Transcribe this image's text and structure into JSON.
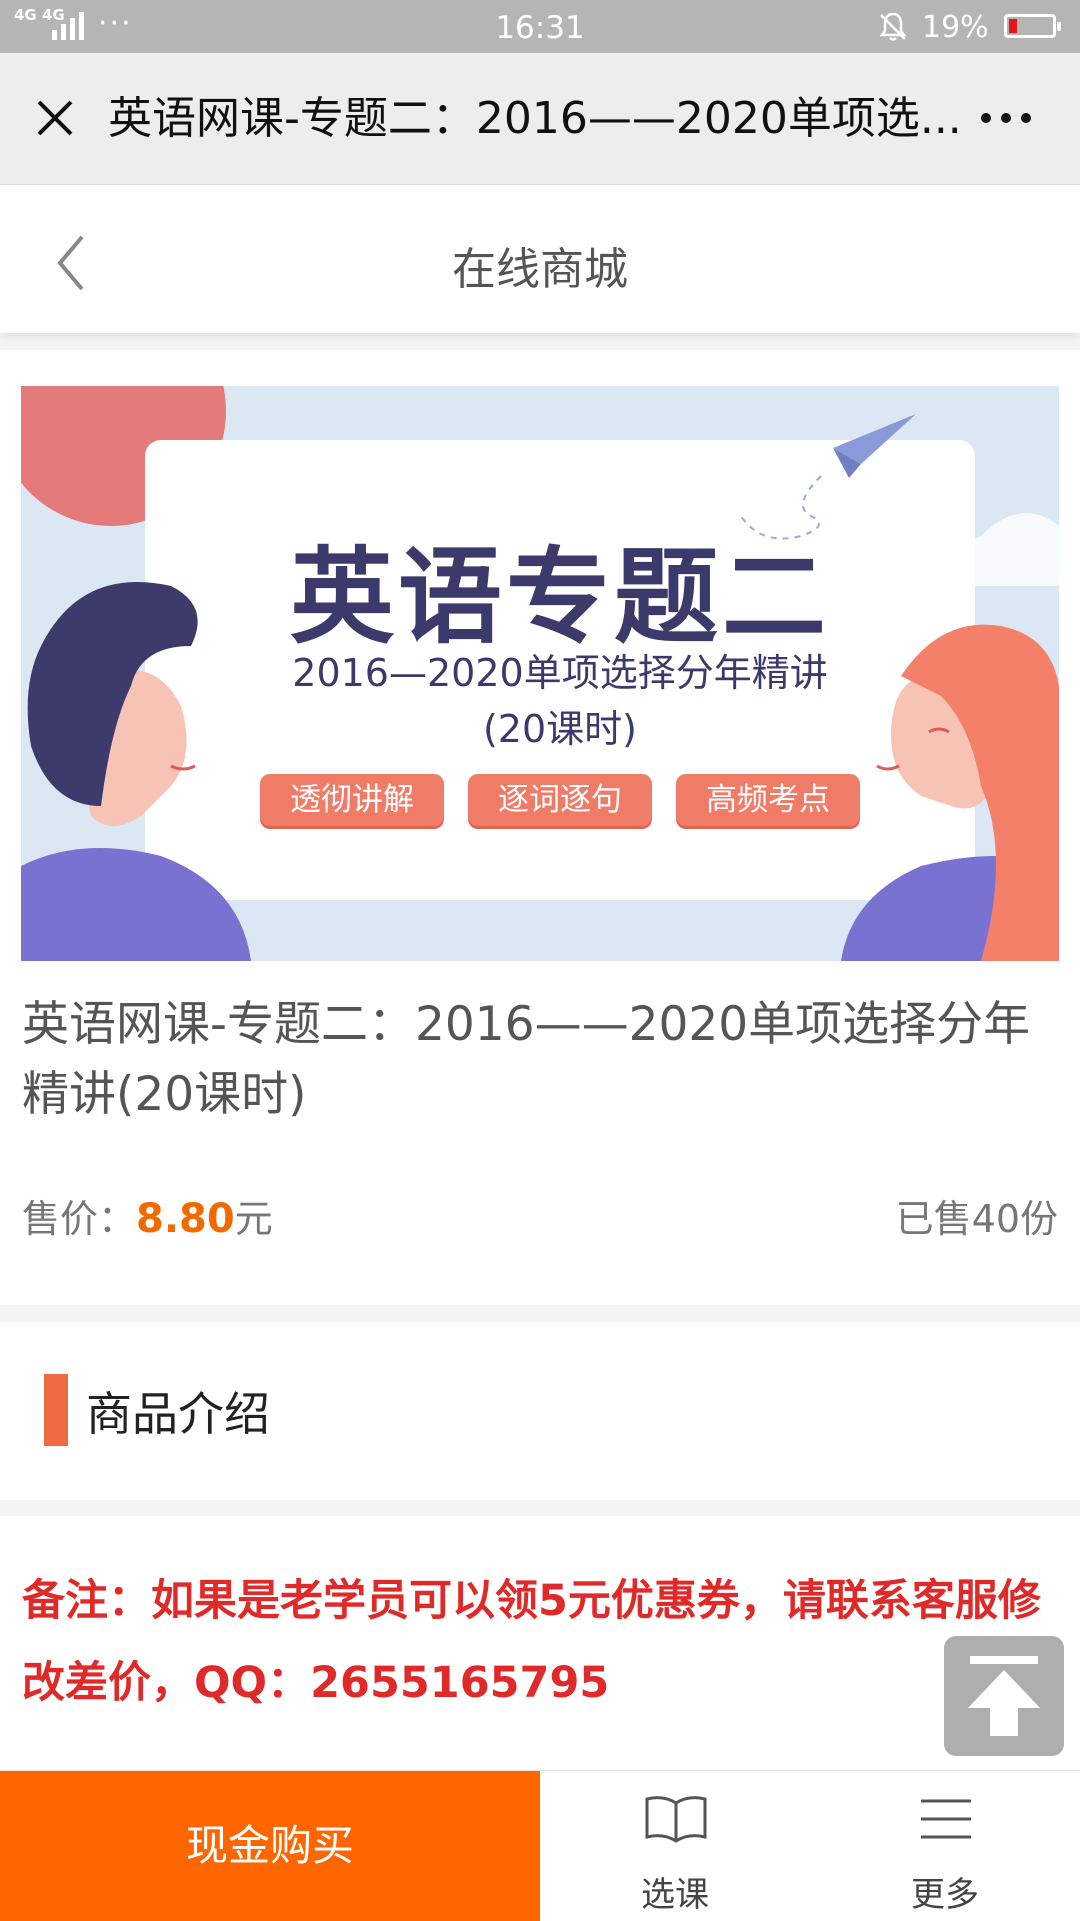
{
  "status_bar": {
    "signal": "4G 4G",
    "dots": "···",
    "time": "16:31",
    "battery_percent": "19%",
    "battery_level": 0.19,
    "battery_color": "#e01818"
  },
  "title_bar": {
    "title": "英语网课-专题二：2016——2020单项选...",
    "close_icon": "close-icon",
    "more_icon": "more-dots-icon"
  },
  "page_header": {
    "title": "在线商城",
    "back_icon": "chevron-left-icon"
  },
  "product": {
    "banner": {
      "headline": "英语专题二",
      "subtitle_line1": "2016—2020单项选择分年精讲",
      "subtitle_line2": "(20课时)",
      "tags": [
        "透彻讲解",
        "逐词逐句",
        "高频考点"
      ]
    },
    "title": "英语网课-专题二：2016——2020单项选择分年精讲(20课时)",
    "price_label": "售价：",
    "price_value": "8.80",
    "price_unit": "元",
    "sold": "已售40份",
    "price_color": "#f06a00"
  },
  "intro": {
    "heading": "商品介绍",
    "accent_color": "#f06a43"
  },
  "description": {
    "note": "备注：如果是老学员可以领5元优惠券，请联系客服修改差价，QQ：2655165795",
    "note_color": "#e02a2a"
  },
  "back_to_top_icon": "arrow-up-icon",
  "bottom_bar": {
    "buy_label": "现金购买",
    "buy_color": "#ff6600",
    "courses_label": "选课",
    "courses_icon": "open-book-icon",
    "more_label": "更多",
    "more_icon": "menu-lines-icon"
  }
}
